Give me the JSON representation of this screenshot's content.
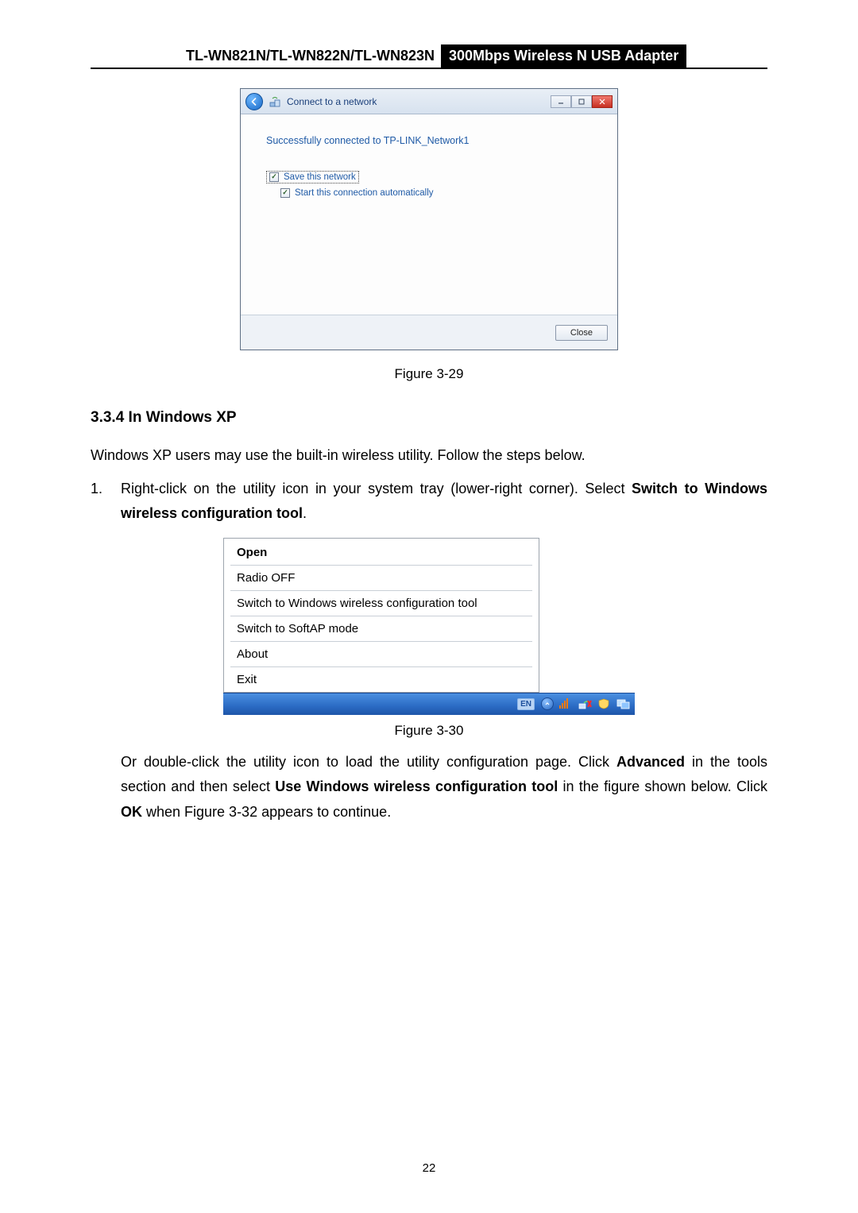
{
  "header": {
    "left": "TL-WN821N/TL-WN822N/TL-WN823N",
    "right": "300Mbps Wireless N USB Adapter"
  },
  "dialog": {
    "title": "Connect to a network",
    "success_text": "Successfully connected to TP-LINK_Network1",
    "save_label": "Save this network",
    "start_label": "Start this connection automatically",
    "close_label": "Close"
  },
  "fig329": "Figure 3-29",
  "section_heading": "3.3.4  In Windows XP",
  "intro_text": "Windows XP users may use the built-in wireless utility. Follow the steps below.",
  "step1": {
    "num": "1.",
    "pre": "Right-click on the utility icon in your system tray (lower-right corner). Select ",
    "bold": "Switch to Windows wireless configuration tool",
    "post": "."
  },
  "menu": {
    "open": "Open",
    "radio_off": "Radio OFF",
    "switch_win": "Switch to Windows wireless configuration tool",
    "switch_softap": "Switch to SoftAP mode",
    "about": "About",
    "exit": "Exit",
    "lang": "EN"
  },
  "fig330": "Figure 3-30",
  "para2": {
    "t1": "Or double-click the utility icon to load the utility configuration page. Click ",
    "b1": "Advanced",
    "t2": " in the tools section and then select ",
    "b2": "Use Windows wireless configuration tool",
    "t3": " in the figure shown below. Click ",
    "b3": "OK",
    "t4": " when Figure 3-32 appears to continue."
  },
  "page_number": "22"
}
